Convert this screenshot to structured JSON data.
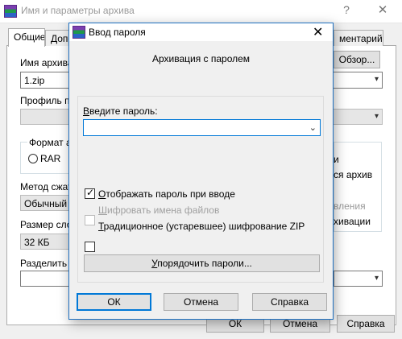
{
  "background_window": {
    "title": "Имя и параметры архива",
    "help_label": "?",
    "close_label": "✕",
    "tabs": [
      {
        "label": "Общие"
      },
      {
        "label": "Допо"
      },
      {
        "label": "ментарий"
      }
    ],
    "archive_name_label": "Имя архива",
    "archive_name_value": "1.zip",
    "browse_button": "Обзор...",
    "profile_label": "Профиль по",
    "format_label": "Формат ар",
    "format_rar": "RAR",
    "right_option_1": "и",
    "right_option_2": "ся архив",
    "right_option_3": "вления",
    "right_option_4": "хивации",
    "method_label": "Метод сжат",
    "method_value": "Обычный",
    "dict_size_label": "Размер слов",
    "dict_size_value": "32 КБ",
    "split_label": "Разделить н",
    "ok_button": "ОК",
    "cancel_button": "Отмена",
    "help_button": "Справка"
  },
  "dialog": {
    "title": "Ввод пароля",
    "close_label": "✕",
    "subtitle": "Архивация с паролем",
    "password_label_underlined": "В",
    "password_label_rest": "ведите пароль:",
    "password_value": "",
    "show_password_u": "О",
    "show_password_rest": "тображать пароль при вводе",
    "show_password_checked": true,
    "encrypt_names_u": "Ш",
    "encrypt_names_rest": "ифровать имена файлов",
    "encrypt_names_checked": false,
    "legacy_zip_u": "Т",
    "legacy_zip_rest": "радиционное (устаревшее) шифрование ZIP",
    "legacy_zip_checked": false,
    "organize_button_u": "У",
    "organize_button_rest": "порядочить пароли...",
    "ok_button": "ОК",
    "cancel_button": "Отмена",
    "help_button": "Справка"
  }
}
